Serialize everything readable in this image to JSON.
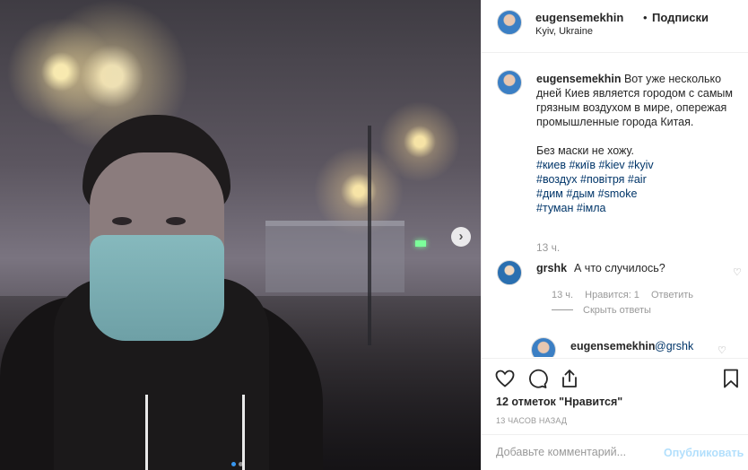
{
  "post": {
    "author": "eugensemekhin",
    "separator": "•",
    "follow_label": "Подписки",
    "location": "Kyiv, Ukraine"
  },
  "caption": {
    "author": "eugensemekhin",
    "text": "Вот уже несколько дней Киев является городом с самым грязным воздухом в мире, опережая промышленные города Китая.",
    "text2": "Без маски не хожу.",
    "tags": [
      "#киев",
      "#київ",
      "#kiev",
      "#kyiv",
      "#воздух",
      "#повітря",
      "#air",
      "#дим",
      "#дым",
      "#smoke",
      "#туман",
      "#імла"
    ],
    "time": "13 ч."
  },
  "comment": {
    "author": "grshk",
    "text": "А что случилось?",
    "time": "13 ч.",
    "likes_label": "Нравится: 1",
    "reply_label": "Ответить",
    "hide_replies_label": "Скрыть ответы"
  },
  "subreply": {
    "author": "eugensemekhin",
    "mention": "@grshk"
  },
  "actions": {
    "likes_text": "12 отметок \"Нравится\"",
    "date": "13 ЧАСОВ НАЗАД"
  },
  "add_comment": {
    "placeholder": "Добавьте комментарий...",
    "publish_label": "Опубликовать"
  },
  "carousel": {
    "next_icon": "chevron-right-icon",
    "slide_count": 2,
    "active_slide": 1
  },
  "colors": {
    "link": "#003569",
    "accent": "#3897f0",
    "publish_disabled": "#b2dffc",
    "muted": "#999999"
  }
}
